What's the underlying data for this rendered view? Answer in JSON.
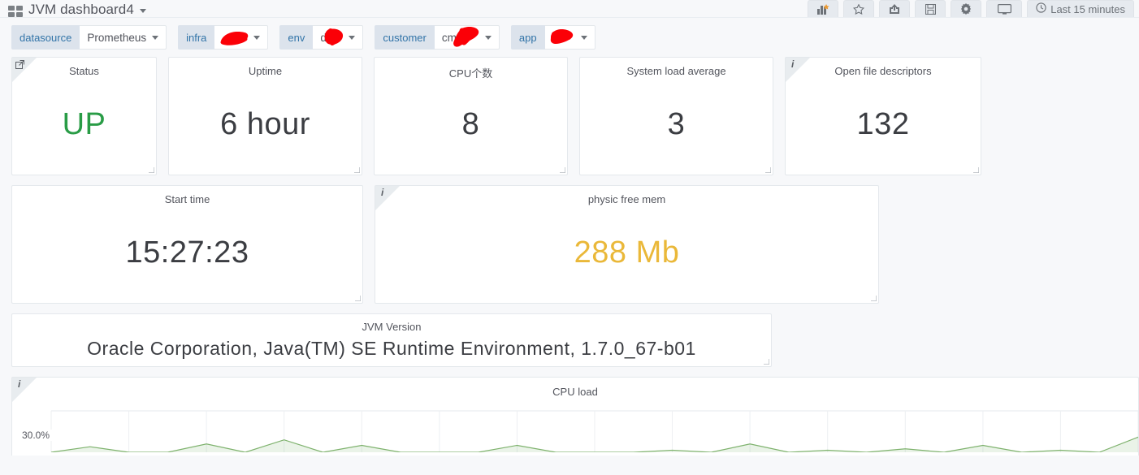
{
  "navbar": {
    "dashboard_icon": "dashboard-grid-icon",
    "title": "JVM dashboard4",
    "title_caret": "chevron-down-icon",
    "buttons": [
      {
        "name": "add-panel-button",
        "icon": "add-panel-icon"
      },
      {
        "name": "star-button",
        "icon": "star-icon"
      },
      {
        "name": "share-button",
        "icon": "share-icon"
      },
      {
        "name": "save-button",
        "icon": "save-icon"
      },
      {
        "name": "settings-button",
        "icon": "gear-icon"
      },
      {
        "name": "kiosk-button",
        "icon": "tv-icon"
      }
    ],
    "time_picker": {
      "icon": "clock-icon",
      "label": "Last 15 minutes"
    }
  },
  "template_variables": [
    {
      "label": "datasource",
      "value": "Prometheus",
      "redacted": false
    },
    {
      "label": "infra",
      "value": "",
      "redacted": true
    },
    {
      "label": "env",
      "value": "d",
      "redacted": true
    },
    {
      "label": "customer",
      "value": "cm",
      "redacted": true
    },
    {
      "label": "app",
      "value": "",
      "redacted": true
    }
  ],
  "panels": {
    "row1": [
      {
        "title": "Status",
        "value": "UP",
        "color": "#299c46",
        "corner": "link",
        "corner_icon": "external-link-icon"
      },
      {
        "title": "Uptime",
        "value": "6 hour",
        "color": "#3b3d42",
        "corner": "none",
        "corner_icon": ""
      },
      {
        "title": "CPU个数",
        "value": "8",
        "color": "#3b3d42",
        "corner": "none",
        "corner_icon": ""
      },
      {
        "title": "System load average",
        "value": "3",
        "color": "#3b3d42",
        "corner": "none",
        "corner_icon": ""
      },
      {
        "title": "Open file descriptors",
        "value": "132",
        "color": "#3b3d42",
        "corner": "info",
        "corner_icon": "info-icon"
      }
    ],
    "row2": [
      {
        "title": "Start time",
        "value": "15:27:23",
        "color": "#3b3d42",
        "corner": "none",
        "corner_icon": ""
      },
      {
        "title": "physic free mem",
        "value": "288 Mb",
        "color": "#eab839",
        "corner": "info",
        "corner_icon": "info-icon"
      }
    ],
    "row3": [
      {
        "title": "JVM Version",
        "value": "Oracle Corporation, Java(TM) SE Runtime Environment, 1.7.0_67-b01",
        "color": "#3b3d42",
        "corner": "none",
        "corner_icon": ""
      }
    ]
  },
  "graph_panel": {
    "title": "CPU load",
    "corner_icon": "info-icon"
  },
  "chart_data": {
    "type": "area",
    "title": "CPU load",
    "xlabel": "",
    "ylabel": "",
    "ytick_labels": [
      "30.0%"
    ],
    "ylim": [
      0,
      30
    ],
    "grid": true,
    "legend_position": "none",
    "line_color": "#7eb26d",
    "fill_color": "#7eb26d",
    "series": [
      {
        "name": "CPU load",
        "x": [
          0,
          1,
          2,
          3,
          4,
          5,
          6,
          7,
          8,
          9,
          10,
          11,
          12,
          13,
          14,
          15,
          16,
          17,
          18,
          19,
          20,
          21,
          22,
          23,
          24,
          25,
          26,
          27,
          28
        ],
        "values": [
          0,
          4,
          0,
          0,
          6,
          0,
          9,
          0,
          5,
          0,
          0,
          0,
          5,
          0,
          0,
          0,
          1.5,
          0,
          6,
          0,
          1.5,
          0,
          2.5,
          0,
          5,
          0,
          1.5,
          0,
          11
        ]
      }
    ]
  }
}
